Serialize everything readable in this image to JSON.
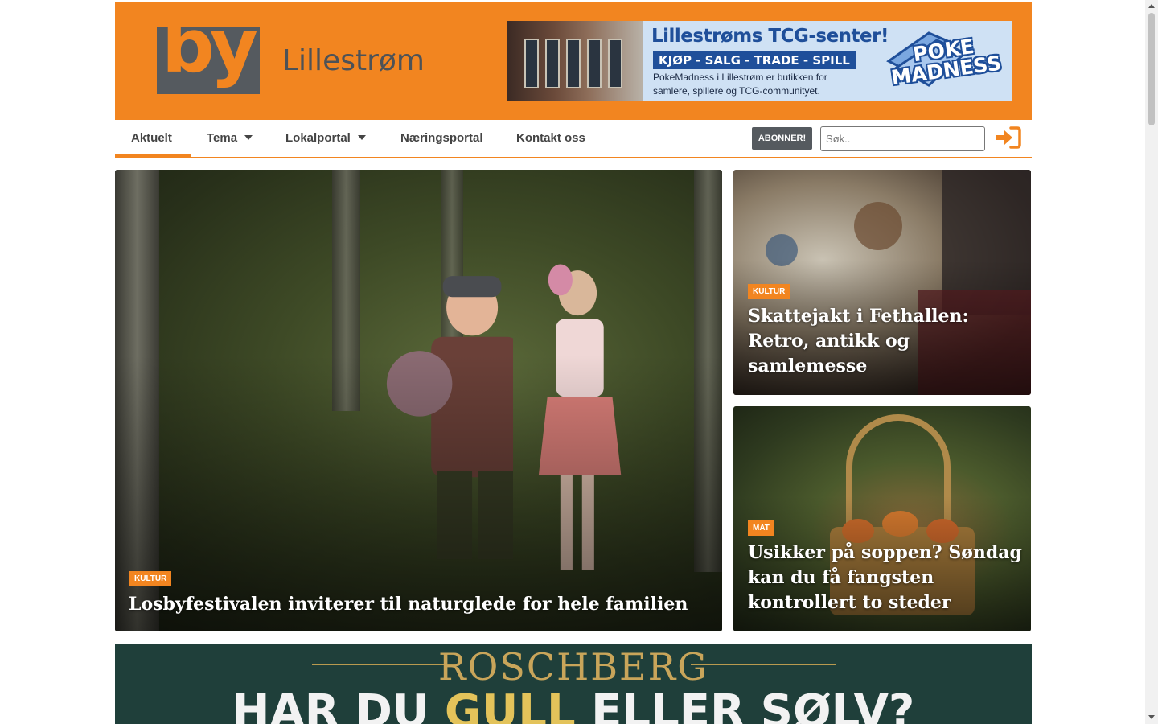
{
  "header": {
    "logo_text": "by",
    "city_name": "Lillestrøm"
  },
  "top_ad": {
    "title": "Lillestrøms TCG-senter!",
    "tagline": "KJØP - SALG - TRADE - SPILL",
    "line1": "PokeMadness i Lillestrøm er butikken for",
    "line2": "samlere, spillere og TCG-communityet.",
    "logo_line1": "POKE",
    "logo_line2": "MADNESS"
  },
  "nav": {
    "items": [
      {
        "label": "Aktuelt",
        "has_dropdown": false,
        "active": true
      },
      {
        "label": "Tema",
        "has_dropdown": true,
        "active": false
      },
      {
        "label": "Lokalportal",
        "has_dropdown": true,
        "active": false
      },
      {
        "label": "Næringsportal",
        "has_dropdown": false,
        "active": false
      },
      {
        "label": "Kontakt oss",
        "has_dropdown": false,
        "active": false
      }
    ],
    "subscribe_label": "ABONNER!",
    "search_placeholder": "Søk..",
    "login_icon": "sign-in-icon",
    "accent_color": "#f28520"
  },
  "articles": {
    "main": {
      "category": "KULTUR",
      "headline": "Losbyfestivalen inviterer til naturglede for hele familien"
    },
    "side1": {
      "category": "KULTUR",
      "headline": "Skattejakt i Fethallen: Retro, antikk og samlemesse"
    },
    "side2": {
      "category": "MAT",
      "headline": "Usikker på soppen? Søndag kan du få fangsten kontrollert to steder"
    }
  },
  "bottom_ad": {
    "brand": "ROSCHBERG",
    "headline_part1": "HAR DU ",
    "headline_gold": "GULL",
    "headline_part2": " ELLER SØLV?"
  }
}
